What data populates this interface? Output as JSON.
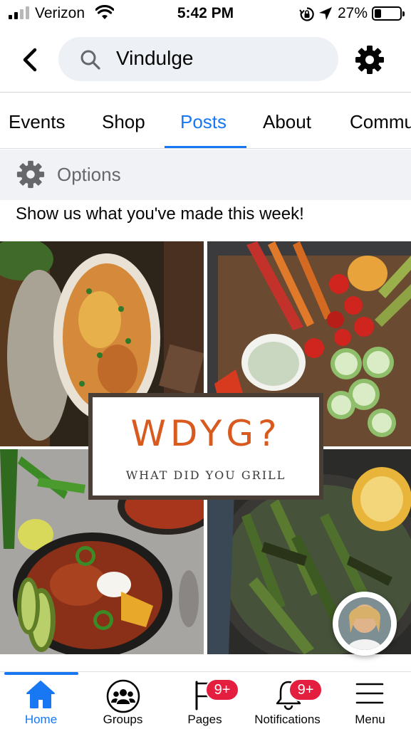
{
  "status_bar": {
    "carrier": "Verizon",
    "time": "5:42 PM",
    "battery_percent": "27%"
  },
  "search": {
    "query": "Vindulge"
  },
  "tabs": [
    {
      "label": "Events",
      "active": false
    },
    {
      "label": "Shop",
      "active": false
    },
    {
      "label": "Posts",
      "active": true
    },
    {
      "label": "About",
      "active": false
    },
    {
      "label": "Commu",
      "active": false
    }
  ],
  "options": {
    "label": "Options"
  },
  "post": {
    "text": "Show us what you've made this week!",
    "banner_title": "WDYG?",
    "banner_subtitle": "WHAT DID YOU GRILL"
  },
  "bottom_nav": [
    {
      "label": "Home",
      "icon": "home-icon",
      "active": true
    },
    {
      "label": "Groups",
      "icon": "groups-icon",
      "active": false
    },
    {
      "label": "Pages",
      "icon": "pages-flag-icon",
      "active": false,
      "badge": "9+"
    },
    {
      "label": "Notifications",
      "icon": "bell-icon",
      "active": false,
      "badge": "9+"
    },
    {
      "label": "Menu",
      "icon": "hamburger-menu-icon",
      "active": false
    }
  ],
  "colors": {
    "accent": "#1877f2",
    "badge": "#e41e3f",
    "banner_title": "#d85a1e",
    "options_bg": "#f0f2f5"
  }
}
